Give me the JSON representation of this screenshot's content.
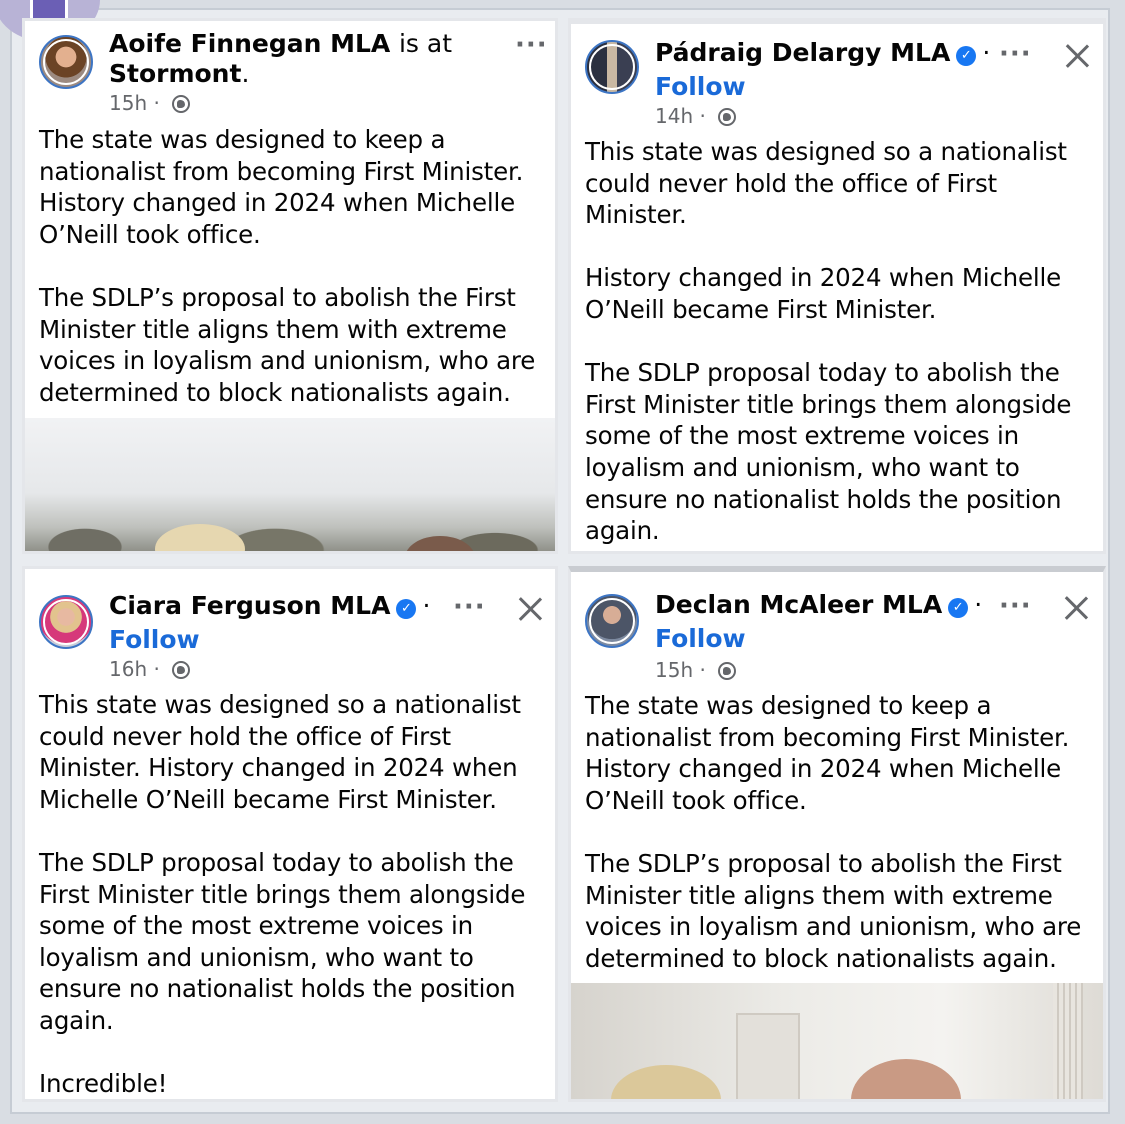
{
  "posts": [
    {
      "author": "Aoife Finnegan MLA",
      "checkin_verb": "is at",
      "location": "Stormont",
      "time": "15h",
      "body": "The state was designed to keep a\nnationalist from becoming First Minister.\nHistory changed in 2024 when Michelle\nO’Neill took office.\n\nThe SDLP’s proposal to abolish the First\nMinister title aligns them with extreme\nvoices in loyalism and unionism, who are\ndetermined to block nationalists again."
    },
    {
      "author": "Pádraig Delargy MLA",
      "follow": "Follow",
      "separator": "·",
      "time": "14h",
      "body": "This state was designed so a nationalist\ncould never hold the office of First\nMinister.\n\nHistory changed in 2024 when Michelle\nO’Neill became First Minister.\n\nThe SDLP proposal today to abolish the\nFirst Minister title brings them alongside\nsome of the most extreme voices in\nloyalism and unionism, who want to\nensure no nationalist holds the position\nagain."
    },
    {
      "author": "Ciara Ferguson MLA",
      "follow": "Follow",
      "separator": "·",
      "time": "16h",
      "body": "This state was designed so a nationalist\ncould never hold the office of First\nMinister. History changed in 2024 when\nMichelle O’Neill became First Minister.\n\nThe SDLP proposal today to abolish the\nFirst Minister title brings them alongside\nsome of the most extreme voices in\nloyalism and unionism, who want to\nensure no nationalist holds the position\nagain.\n\nIncredible!"
    },
    {
      "author": "Declan McAleer MLA",
      "follow": "Follow",
      "separator": "·",
      "time": "15h",
      "body": "The state was designed to keep a\nnationalist from becoming First Minister.\nHistory changed in 2024 when Michelle\nO’Neill took office.\n\nThe SDLP’s proposal to abolish the First\nMinister title aligns them with extreme\nvoices in loyalism and unionism, who are\ndetermined to block nationalists again."
    }
  ],
  "meta_separator": "·",
  "verified_badge": "✓",
  "more_icon": "···",
  "checkin_end": ".",
  "colors": {
    "follow": "#1a6ad8",
    "verified": "#1877f2",
    "meta": "#65676b"
  },
  "icons": [
    "globe-icon",
    "more-options-icon",
    "close-icon",
    "verified-badge-icon"
  ]
}
